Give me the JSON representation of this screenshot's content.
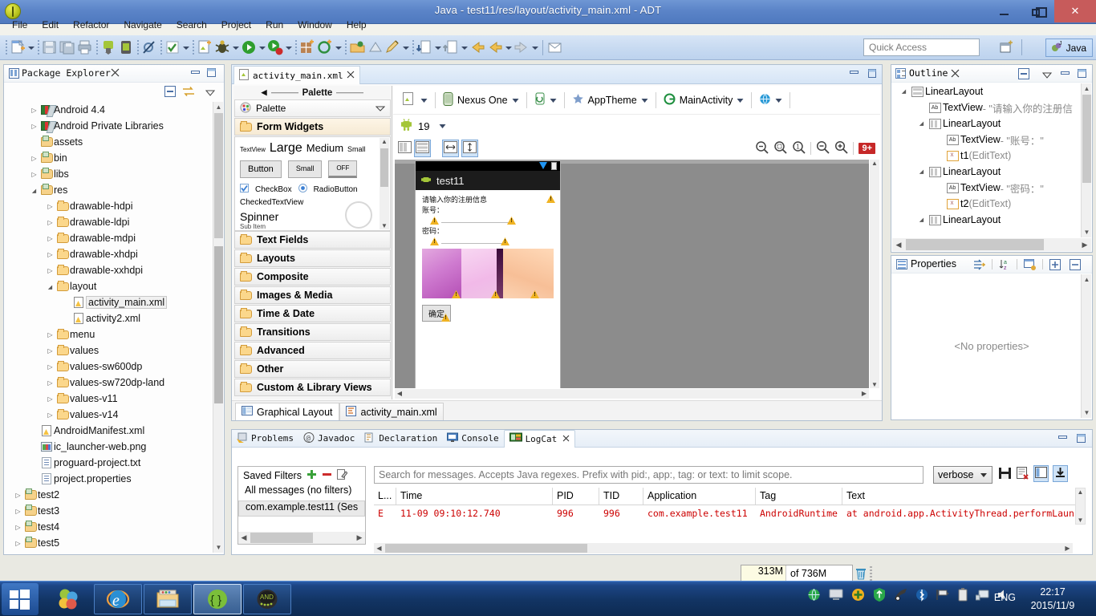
{
  "window": {
    "title": "Java - test11/res/layout/activity_main.xml - ADT",
    "minimize_label": "—",
    "maximize_label": "❐",
    "close_label": "✕"
  },
  "menubar": {
    "items": [
      "File",
      "Edit",
      "Refactor",
      "Navigate",
      "Search",
      "Project",
      "Run",
      "Window",
      "Help"
    ]
  },
  "toolbar": {
    "quick_access_placeholder": "Quick Access",
    "perspective_label": "Java",
    "icons": [
      "new-file-icon",
      "new-file-dropdown",
      "save-icon",
      "save-all-icon",
      "print-icon",
      "android-sdk-manager-icon",
      "android-avd-manager-icon",
      "disabled-breakpoint-icon",
      "check-mark-icon",
      "check-dropdown",
      "new-android-icon",
      "debug-icon",
      "debug-dropdown",
      "run-icon",
      "run-dropdown",
      "run-external-icon",
      "run-external-dropdown",
      "new-java-package-icon",
      "new-class-icon",
      "new-class-dropdown",
      "open-type-icon",
      "search-icon",
      "pencil-icon",
      "pencil-dropdown",
      "next-annotation-icon",
      "next-annotation-dropdown",
      "previous-annotation-icon",
      "previous-annotation-dropdown",
      "back-icon",
      "back-dropdown",
      "forward-icon",
      "forward-dropdown",
      "open-task-icon"
    ]
  },
  "package_explorer": {
    "title": "Package Explorer",
    "close_label": "✕",
    "tools": [
      "collapse-all-icon",
      "link-with-editor-icon",
      "view-menu-icon"
    ],
    "tree": [
      {
        "label": "Android 4.4",
        "indent": 1,
        "arrow": "closed",
        "icon": "library-icon"
      },
      {
        "label": "Android Private Libraries",
        "indent": 1,
        "arrow": "closed",
        "icon": "library-icon"
      },
      {
        "label": "assets",
        "indent": 1,
        "arrow": "none",
        "icon": "source-folder-icon"
      },
      {
        "label": "bin",
        "indent": 1,
        "arrow": "closed",
        "icon": "source-folder-icon"
      },
      {
        "label": "libs",
        "indent": 1,
        "arrow": "closed",
        "icon": "source-folder-icon"
      },
      {
        "label": "res",
        "indent": 1,
        "arrow": "open",
        "icon": "source-folder-icon"
      },
      {
        "label": "drawable-hdpi",
        "indent": 2,
        "arrow": "closed",
        "icon": "folder-icon"
      },
      {
        "label": "drawable-ldpi",
        "indent": 2,
        "arrow": "closed",
        "icon": "folder-icon"
      },
      {
        "label": "drawable-mdpi",
        "indent": 2,
        "arrow": "closed",
        "icon": "folder-icon"
      },
      {
        "label": "drawable-xhdpi",
        "indent": 2,
        "arrow": "closed",
        "icon": "folder-icon"
      },
      {
        "label": "drawable-xxhdpi",
        "indent": 2,
        "arrow": "closed",
        "icon": "folder-icon"
      },
      {
        "label": "layout",
        "indent": 2,
        "arrow": "open",
        "icon": "folder-icon"
      },
      {
        "label": "activity_main.xml",
        "indent": 3,
        "arrow": "none",
        "icon": "xml-file-icon",
        "selected": true
      },
      {
        "label": "activity2.xml",
        "indent": 3,
        "arrow": "none",
        "icon": "xml-file-icon"
      },
      {
        "label": "menu",
        "indent": 2,
        "arrow": "closed",
        "icon": "folder-icon"
      },
      {
        "label": "values",
        "indent": 2,
        "arrow": "closed",
        "icon": "folder-icon"
      },
      {
        "label": "values-sw600dp",
        "indent": 2,
        "arrow": "closed",
        "icon": "folder-icon"
      },
      {
        "label": "values-sw720dp-land",
        "indent": 2,
        "arrow": "closed",
        "icon": "folder-icon"
      },
      {
        "label": "values-v11",
        "indent": 2,
        "arrow": "closed",
        "icon": "folder-icon"
      },
      {
        "label": "values-v14",
        "indent": 2,
        "arrow": "closed",
        "icon": "folder-icon"
      },
      {
        "label": "AndroidManifest.xml",
        "indent": 1,
        "arrow": "none",
        "icon": "xml-file-icon"
      },
      {
        "label": "ic_launcher-web.png",
        "indent": 1,
        "arrow": "none",
        "icon": "png-file-icon"
      },
      {
        "label": "proguard-project.txt",
        "indent": 1,
        "arrow": "none",
        "icon": "text-file-icon"
      },
      {
        "label": "project.properties",
        "indent": 1,
        "arrow": "none",
        "icon": "text-file-icon"
      },
      {
        "label": "test2",
        "indent": 0,
        "arrow": "closed",
        "icon": "project-icon"
      },
      {
        "label": "test3",
        "indent": 0,
        "arrow": "closed",
        "icon": "project-icon"
      },
      {
        "label": "test4",
        "indent": 0,
        "arrow": "closed",
        "icon": "project-icon"
      },
      {
        "label": "test5",
        "indent": 0,
        "arrow": "closed",
        "icon": "project-icon"
      }
    ]
  },
  "editor": {
    "tab_label": "activity_main.xml",
    "tab_close": "✕",
    "bottom_tabs": [
      {
        "label": "Graphical Layout",
        "active": true,
        "icon": "layout-view-icon"
      },
      {
        "label": "activity_main.xml",
        "active": false,
        "icon": "xml-view-icon"
      }
    ],
    "palette": {
      "handle_label": "Palette",
      "header_label": "Palette",
      "open_category": "Form Widgets",
      "form_widgets": {
        "textview_small": "TextView",
        "large": "Large",
        "medium": "Medium",
        "small": "Small",
        "button": "Button",
        "small_button": "Small",
        "toggle": "OFF",
        "checkbox": "CheckBox",
        "radiobutton": "RadioButton",
        "checkedtextview": "CheckedTextView",
        "spinner": "Spinner",
        "subitem": "Sub Item"
      },
      "categories": [
        "Text Fields",
        "Layouts",
        "Composite",
        "Images & Media",
        "Time & Date",
        "Transitions",
        "Advanced",
        "Other",
        "Custom & Library Views"
      ]
    },
    "config": {
      "resource_label": "",
      "device": "Nexus One",
      "orientation": "",
      "theme": "AppTheme",
      "activity": "MainActivity",
      "locale": "",
      "api_level": "19",
      "zoom_icons": [
        "zoom-fit-icon",
        "zoom-fit-selection-icon",
        "zoom-100-icon",
        "zoom-out-icon",
        "zoom-in-icon"
      ],
      "view_mode_icons": [
        "show-included-icon",
        "render-mode-icon",
        "match-width-icon",
        "match-height-icon"
      ],
      "lint_badge": "9+"
    },
    "preview": {
      "app_title": "test11",
      "hint_text": "请输入你的注册信息",
      "account_label": "账号：",
      "password_label": "密码：",
      "ok_button": "确定"
    }
  },
  "outline": {
    "title": "Outline",
    "close_label": "✕",
    "tools": [
      "collapse-all-icon",
      "view-menu-icon",
      "minimize-icon",
      "maximize-icon"
    ],
    "tree": [
      {
        "label": "LinearLayout",
        "value": "",
        "indent": 0,
        "arrow": "open",
        "icon": "linearlayout-vertical-icon"
      },
      {
        "label": "TextView",
        "value": " - \"请输入你的注册信",
        "indent": 1,
        "arrow": "none",
        "icon": "textview-icon"
      },
      {
        "label": "LinearLayout",
        "value": "",
        "indent": 1,
        "arrow": "open",
        "icon": "linearlayout-horizontal-icon"
      },
      {
        "label": "TextView",
        "value": " - \"账号：\"",
        "indent": 2,
        "arrow": "none",
        "icon": "textview-icon"
      },
      {
        "label": "t1",
        "value": " (EditText)",
        "indent": 2,
        "arrow": "none",
        "icon": "edittext-icon"
      },
      {
        "label": "LinearLayout",
        "value": "",
        "indent": 1,
        "arrow": "open",
        "icon": "linearlayout-horizontal-icon"
      },
      {
        "label": "TextView",
        "value": " - \"密码：\"",
        "indent": 2,
        "arrow": "none",
        "icon": "textview-icon"
      },
      {
        "label": "t2",
        "value": " (EditText)",
        "indent": 2,
        "arrow": "none",
        "icon": "edittext-icon"
      },
      {
        "label": "LinearLayout",
        "value": "",
        "indent": 1,
        "arrow": "open",
        "icon": "linearlayout-horizontal-icon"
      }
    ]
  },
  "properties": {
    "title": "Properties",
    "empty_text": "<No properties>",
    "tools": [
      "show-advanced-icon",
      "sort-alpha-icon",
      "default-properties-icon",
      "expand-all-icon",
      "collapse-all-icon"
    ]
  },
  "logcat": {
    "tabs": [
      {
        "label": "Problems",
        "active": false,
        "icon": "problems-icon"
      },
      {
        "label": "Javadoc",
        "active": false,
        "icon": "javadoc-icon"
      },
      {
        "label": "Declaration",
        "active": false,
        "icon": "declaration-icon"
      },
      {
        "label": "Console",
        "active": false,
        "icon": "console-icon"
      },
      {
        "label": "LogCat",
        "active": true,
        "icon": "logcat-icon"
      }
    ],
    "tab_close": "✕",
    "saved_filters_label": "Saved Filters",
    "filter_buttons": [
      "add-filter-icon",
      "remove-filter-icon",
      "edit-filter-icon"
    ],
    "filters": [
      {
        "label": "All messages (no filters)",
        "selected": false
      },
      {
        "label": "com.example.test11 (Ses",
        "selected": true
      }
    ],
    "search_placeholder": "Search for messages. Accepts Java regexes. Prefix with pid:, app:, tag: or text: to limit scope.",
    "level": "verbose",
    "tools": [
      "save-log-icon",
      "clear-log-icon",
      "display-view-icon",
      "scroll-lock-icon"
    ],
    "columns": [
      "L...",
      "Time",
      "PID",
      "TID",
      "Application",
      "Tag",
      "Text"
    ],
    "rows": [
      {
        "level": "E",
        "time": "11-09 09:10:12.740",
        "pid": "996",
        "tid": "996",
        "application": "com.example.test11",
        "tag": "AndroidRuntime",
        "text": "at android.app.ActivityThread.performLaun"
      }
    ]
  },
  "statusbar": {
    "heap_used": "313M",
    "heap_total": "of 736M",
    "trash_icon": "trash-icon"
  },
  "taskbar": {
    "start_label": "start-icon",
    "apps": [
      {
        "name": "media-player-icon",
        "active": false,
        "pinned": true
      },
      {
        "name": "internet-explorer-icon",
        "active": false
      },
      {
        "name": "file-explorer-icon",
        "active": false
      },
      {
        "name": "eclipse-adt-icon",
        "active": true
      },
      {
        "name": "android-emulator-icon",
        "active": false
      }
    ],
    "tray_icons": [
      "network-globe-icon",
      "monitor-icon",
      "update-icon",
      "security-shield-icon",
      "satellite-icon",
      "bluetooth-icon",
      "flag-icon",
      "battery-icon",
      "display-icon",
      "volume-icon"
    ],
    "language": "ENG",
    "time": "22:17",
    "date": "2015/11/9"
  },
  "colors": {
    "title_bar": "#5b84c8",
    "close_button": "#c75b5b",
    "toolbar": "#c7daf1",
    "error_text": "#cc0000",
    "taskbar": "#123463",
    "accent_blue": "#3f77c4"
  }
}
